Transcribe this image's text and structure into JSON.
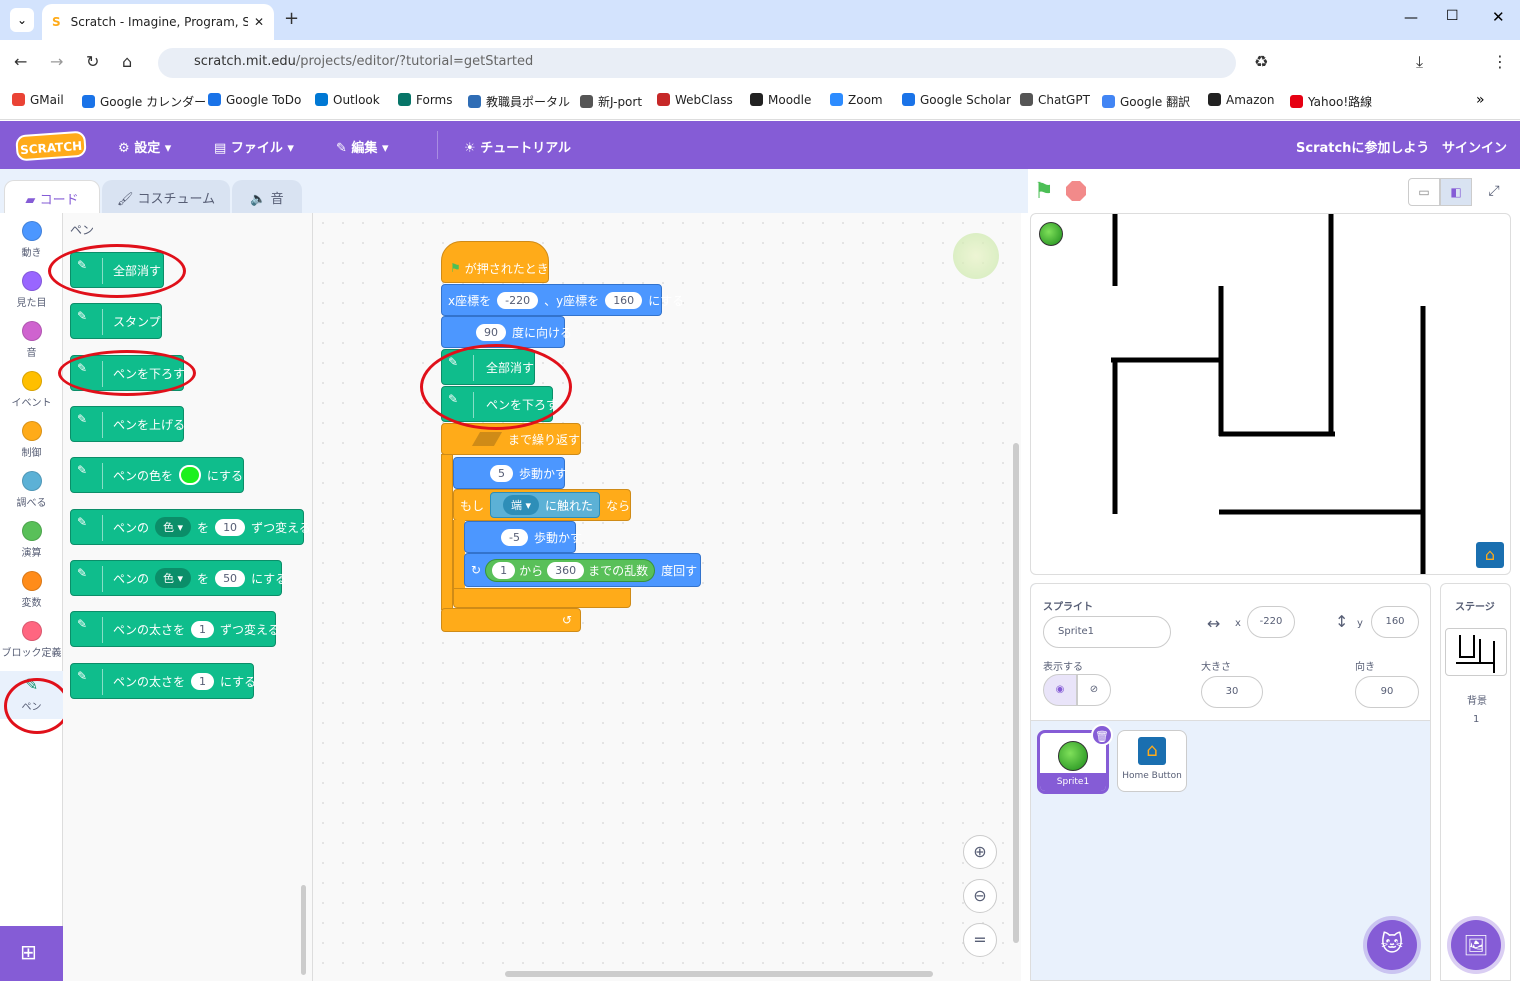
{
  "browser": {
    "tab_title": "Scratch - Imagine, Program, Sha",
    "url_host": "scratch.mit.edu",
    "url_path": "/projects/editor/?tutorial=getStarted",
    "bookmarks": [
      "GMail",
      "Google カレンダー",
      "Google ToDo",
      "Outlook",
      "Forms",
      "教職員ポータル",
      "新J-port",
      "WebClass",
      "Moodle",
      "Zoom",
      "Google Scholar",
      "ChatGPT",
      "Google 翻訳",
      "Amazon",
      "Yahoo!路線"
    ]
  },
  "menu": {
    "logo": "SCRATCH",
    "settings": "設定",
    "file": "ファイル",
    "edit": "編集",
    "tutorial": "チュートリアル",
    "join": "Scratchに参加しよう",
    "signin": "サインイン"
  },
  "tabs": {
    "code": "コード",
    "costume": "コスチューム",
    "sound": "音"
  },
  "categories": [
    {
      "label": "動き",
      "color": "#4c97ff"
    },
    {
      "label": "見た目",
      "color": "#9966ff"
    },
    {
      "label": "音",
      "color": "#cf63cf"
    },
    {
      "label": "イベント",
      "color": "#ffbf00"
    },
    {
      "label": "制御",
      "color": "#ffab19"
    },
    {
      "label": "調べる",
      "color": "#5cb1d6"
    },
    {
      "label": "演算",
      "color": "#59c059"
    },
    {
      "label": "変数",
      "color": "#ff8c1a"
    },
    {
      "label": "ブロック定義",
      "color": "#ff6680"
    },
    {
      "label": "ペン",
      "color": "#0fbd8c"
    }
  ],
  "palette": {
    "heading": "ペン",
    "clear": "全部消す",
    "stamp": "スタンプ",
    "pen_down": "ペンを下ろす",
    "pen_up": "ペンを上げる",
    "set_color_a": "ペンの色を",
    "set_color_b": "にする",
    "change_a": "ペンの",
    "change_menu": "色",
    "change_b": "を",
    "change_val": "10",
    "change_c": "ずつ変える",
    "set_a": "ペンの",
    "set_menu": "色",
    "set_b": "を",
    "set_val": "50",
    "set_c": "にする",
    "size_change_a": "ペンの太さを",
    "size_change_val": "1",
    "size_change_b": "ずつ変える",
    "size_set_a": "ペンの太さを",
    "size_set_val": "1",
    "size_set_b": "にする"
  },
  "script": {
    "hat": "が押されたとき",
    "goto_a": "x座標を",
    "goto_x": "-220",
    "goto_b": "、y座標を",
    "goto_y": "160",
    "goto_c": "にする",
    "point_val": "90",
    "point_label": "度に向ける",
    "clear": "全部消す",
    "pen_down": "ペンを下ろす",
    "repeat_until": "まで繰り返す",
    "move_val": "5",
    "move_label": "歩動かす",
    "if_a": "もし",
    "touch_menu": "端",
    "touch_label": "に触れた",
    "if_b": "なら",
    "move2_val": "-5",
    "move2_label": "歩動かす",
    "rand_from": "1",
    "rand_mid": "から",
    "rand_to": "360",
    "rand_label": "までの乱数",
    "turn_label": "度回す"
  },
  "sprite": {
    "header": "スプライト",
    "name": "Sprite1",
    "x_label": "x",
    "x": "-220",
    "y_label": "y",
    "y": "160",
    "show_label": "表示する",
    "size_label": "大きさ",
    "size": "30",
    "direction_label": "向き",
    "direction": "90",
    "thumbs": [
      "Sprite1",
      "Home Button"
    ]
  },
  "stage_pane": {
    "header": "ステージ",
    "backdrops_label": "背景",
    "backdrops_count": "1"
  }
}
